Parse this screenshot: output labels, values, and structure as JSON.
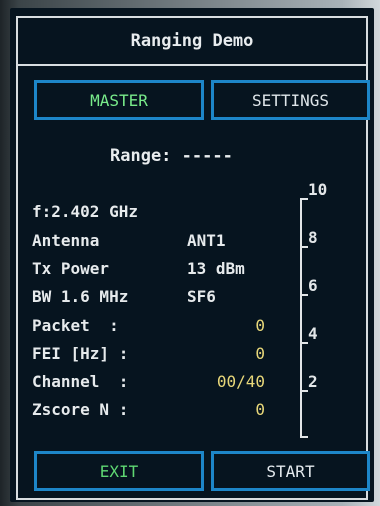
{
  "app": {
    "title": "Ranging Demo"
  },
  "buttons": {
    "master": "MASTER",
    "settings": "SETTINGS",
    "exit": "EXIT",
    "start": "START"
  },
  "range": {
    "label": "Range:",
    "value": "-----"
  },
  "frequency": "f:2.402 GHz",
  "params": [
    {
      "label": "Antenna",
      "value": "ANT1"
    },
    {
      "label": "Tx Power",
      "value": "13 dBm"
    },
    {
      "label": "BW 1.6 MHz",
      "value": "SF6"
    }
  ],
  "stats": [
    {
      "label": "Packet  :",
      "value": "0"
    },
    {
      "label": "FEI [Hz] :",
      "value": "0"
    },
    {
      "label": "Channel  :",
      "value": "00/40"
    },
    {
      "label": "Zscore N :",
      "value": "0"
    }
  ],
  "scale": {
    "ticks": [
      "10",
      "8",
      "6",
      "4",
      "2"
    ]
  },
  "colors": {
    "button_border": "#1d86c8",
    "master_text": "#78ea8a",
    "exit_text": "#5fd873",
    "value_text": "#e8d87a",
    "screen_bg": "#06141f"
  }
}
